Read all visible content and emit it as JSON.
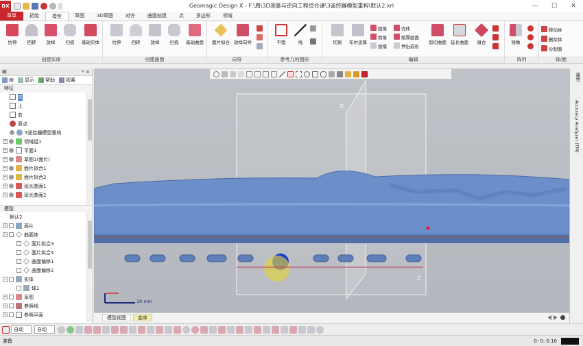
{
  "titlebar": {
    "logo": "DX",
    "title": "Geomagic Design X - F:\\周\\3D测量与逆向工程综合课\\3遥控器模型重构\\默认2.xrl",
    "min": "—",
    "max": "☐",
    "close": "✕"
  },
  "tabs": [
    "草单",
    "初始",
    "模型",
    "草图",
    "3D草图",
    "对齐",
    "曲面创建",
    "点",
    "多边形",
    "领域"
  ],
  "active_tab": "模型",
  "ribbon": {
    "groups": [
      "创建实体",
      "创建曲面",
      "向导",
      "参考几何图形",
      "编辑",
      "阵列",
      "体/面"
    ],
    "solid": [
      "拉伸",
      "回转",
      "放样",
      "扫描",
      "基础实体"
    ],
    "surface": [
      "拉伸",
      "回转",
      "放样",
      "扫描",
      "基础曲面"
    ],
    "wizard": [
      "面片拟合",
      "放样向导"
    ],
    "ref": [
      "平面",
      "线"
    ],
    "edit_big": [
      "切割",
      "布尔运算"
    ],
    "edit_small": [
      "圆角",
      "倒角",
      "拔模",
      "壳体",
      "赋厚曲面",
      "押出成形"
    ],
    "edit_big2": [
      "剪切曲面",
      "延长曲面",
      "缝合"
    ],
    "pattern": [
      "镜像"
    ],
    "body": [
      "移动体",
      "删除体",
      "分割面"
    ]
  },
  "tree": {
    "header": "树",
    "pin": "ᵖ ×",
    "tools": [
      "树",
      "显示",
      "帮助",
      "视素"
    ],
    "section_feature": "特征",
    "features": [
      "前",
      "上",
      "右",
      "原点",
      "3遥控器模型重构",
      "领域组1",
      "平面1",
      "草图1(面片)",
      "面片拟合1",
      "面片拟合2",
      "延长曲面1",
      "延长曲面2"
    ],
    "section_model": "模型",
    "model_group": "默认2",
    "models": [
      "面片",
      "曲面体",
      "面片拟合3",
      "面片拟合4",
      "曲面偏移1",
      "曲面偏移2",
      "实体",
      "球1",
      "草图",
      "参照线",
      "参照平面"
    ]
  },
  "viewport": {
    "label_right": "右",
    "label_top": "上",
    "scale": "10 mm"
  },
  "right_panel": [
    "属性",
    "Accuracy Analyzer (TM)"
  ],
  "view_tabs": [
    "模型视图",
    "变序"
  ],
  "bottombar": {
    "select1": "自动",
    "select2": "自动"
  },
  "status": {
    "left": "准备",
    "time": "0: 0: 0.10"
  }
}
